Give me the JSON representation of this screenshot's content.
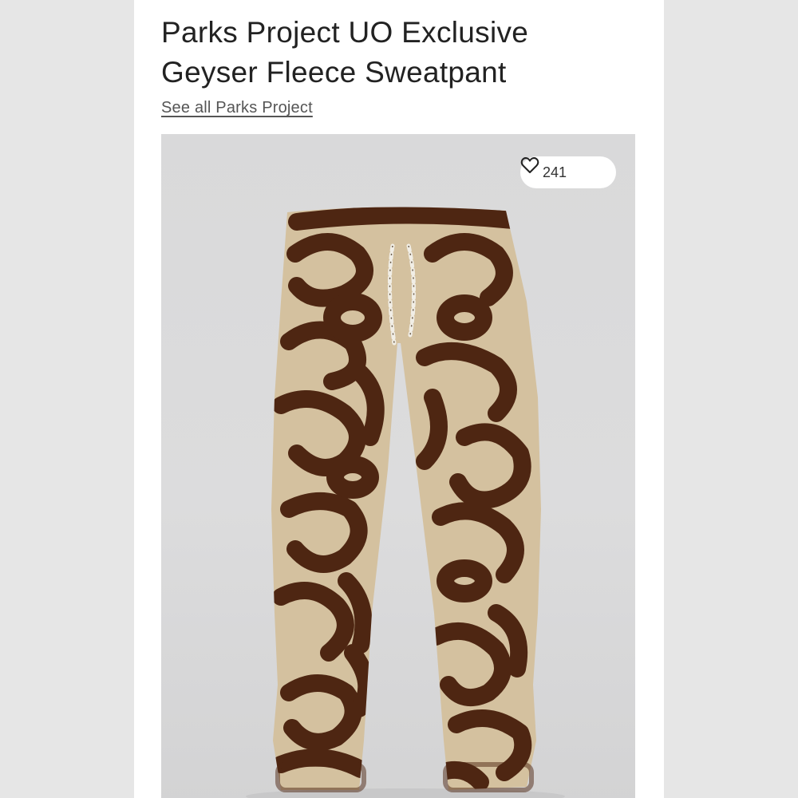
{
  "product": {
    "title_line1": "Parks Project UO Exclusive",
    "title_line2": "Geyser Fleece Sweatpant",
    "brand_link": "See all Parks Project"
  },
  "gallery": {
    "likes": "241",
    "like_icon": "heart-outline-icon",
    "image_subject": "sweatpant-photo"
  },
  "colors": {
    "fleece_base": "#d4c19f",
    "pattern_brown": "#4e2612",
    "background_gray": "#dadadb"
  }
}
